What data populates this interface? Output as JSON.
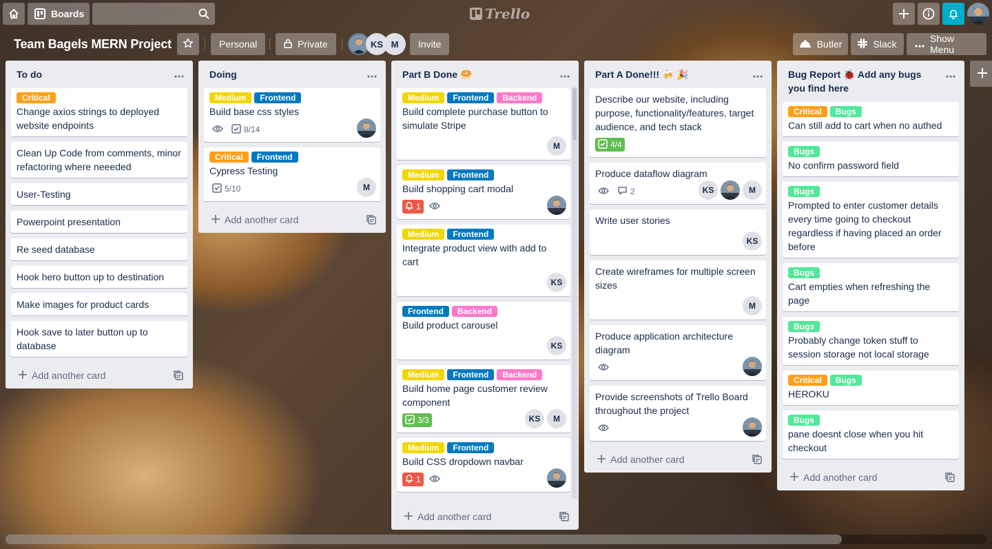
{
  "nav": {
    "boards_label": "Boards",
    "search_placeholder": "",
    "logo_text": "Trello",
    "icons": [
      "home-icon",
      "boards-icon",
      "search-icon",
      "plus-icon",
      "info-icon",
      "bell-icon"
    ]
  },
  "board": {
    "title": "Team Bagels MERN Project",
    "personal_label": "Personal",
    "visibility_label": "Private",
    "invite_label": "Invite",
    "members": [
      "",
      "KS",
      "M"
    ],
    "butler_label": "Butler",
    "slack_label": "Slack",
    "menu_label": "Show Menu"
  },
  "colors": {
    "Critical": "#ff9f1a",
    "Medium": "#f2d600",
    "Frontend": "#0079bf",
    "Backend": "#ff78cb",
    "Bugs": "#51e898",
    "notification": "#00aecc",
    "checklist_done": "#61bd4f",
    "due_alert": "#eb5a46"
  },
  "add_card_label": "Add another card",
  "lists": [
    {
      "title": "To do",
      "cards": [
        {
          "labels": [
            "Critical"
          ],
          "title": "Change axios strings to deployed website endpoints"
        },
        {
          "title": "Clean Up Code from comments, minor refactoring where neeeded"
        },
        {
          "title": "User-Testing"
        },
        {
          "title": "Powerpoint presentation"
        },
        {
          "title": "Re seed database"
        },
        {
          "title": "Hook hero button up to destination"
        },
        {
          "title": "Make images for product cards"
        },
        {
          "title": "Hook save to later button up to database"
        }
      ]
    },
    {
      "title": "Doing",
      "cards": [
        {
          "labels": [
            "Medium",
            "Frontend"
          ],
          "title": "Build base css styles",
          "watch": true,
          "checklist": "8/14",
          "members": [
            "photo"
          ]
        },
        {
          "labels": [
            "Critical",
            "Frontend"
          ],
          "title": "Cypress Testing",
          "checklist": "5/10",
          "members": [
            "M"
          ]
        }
      ]
    },
    {
      "title": "Part B Done 🥯",
      "cards": [
        {
          "labels": [
            "Medium",
            "Frontend",
            "Backend"
          ],
          "title": "Build complete purchase button to simulate Stripe",
          "members": [
            "M"
          ]
        },
        {
          "labels": [
            "Medium",
            "Frontend"
          ],
          "title": "Build shopping cart modal",
          "alert": "1",
          "watch": true,
          "members": [
            "photo"
          ]
        },
        {
          "labels": [
            "Medium",
            "Frontend"
          ],
          "title": "Integrate product view with add to cart",
          "members": [
            "KS"
          ]
        },
        {
          "labels": [
            "Frontend",
            "Backend"
          ],
          "title": "Build product carousel",
          "members": [
            "KS"
          ]
        },
        {
          "labels": [
            "Medium",
            "Frontend",
            "Backend"
          ],
          "title": "Build home page customer review component",
          "checklist_done": "3/3",
          "members": [
            "KS",
            "M"
          ]
        },
        {
          "labels": [
            "Medium",
            "Frontend"
          ],
          "title": "Build CSS dropdown navbar",
          "alert": "1",
          "watch": true,
          "members": [
            "photo"
          ]
        }
      ]
    },
    {
      "title": "Part A Done!!! 🍻 🎉",
      "cards": [
        {
          "title": "Describe our website, including purpose, functionality/features, target audience, and tech stack",
          "checklist_done": "4/4"
        },
        {
          "title": "Produce dataflow diagram",
          "watch": true,
          "comments": "2",
          "members": [
            "KS",
            "photo",
            "M"
          ]
        },
        {
          "title": "Write user stories",
          "members": [
            "KS"
          ]
        },
        {
          "title": "Create wireframes for multiple screen sizes",
          "members": [
            "M"
          ]
        },
        {
          "title": "Produce application architecture diagram",
          "watch": true,
          "members": [
            "photo"
          ]
        },
        {
          "title": "Provide screenshots of Trello Board throughout the project",
          "watch": true,
          "members": [
            "photo"
          ]
        }
      ]
    },
    {
      "title": "Bug Report 🐞 Add any bugs you find here",
      "cards": [
        {
          "labels": [
            "Critical",
            "Bugs"
          ],
          "title": "Can still add to cart when no authed"
        },
        {
          "labels": [
            "Bugs"
          ],
          "title": "No confirm password field"
        },
        {
          "labels": [
            "Bugs"
          ],
          "title": "Prompted to enter customer details every time going to checkout regardless if having placed an order before"
        },
        {
          "labels": [
            "Bugs"
          ],
          "title": "Cart empties when refreshing the page"
        },
        {
          "labels": [
            "Bugs"
          ],
          "title": "Probably change token stuff to session storage not local storage"
        },
        {
          "labels": [
            "Critical",
            "Bugs"
          ],
          "title": "HEROKU"
        },
        {
          "labels": [
            "Bugs"
          ],
          "title": "pane doesnt close when you hit checkout"
        }
      ]
    }
  ]
}
